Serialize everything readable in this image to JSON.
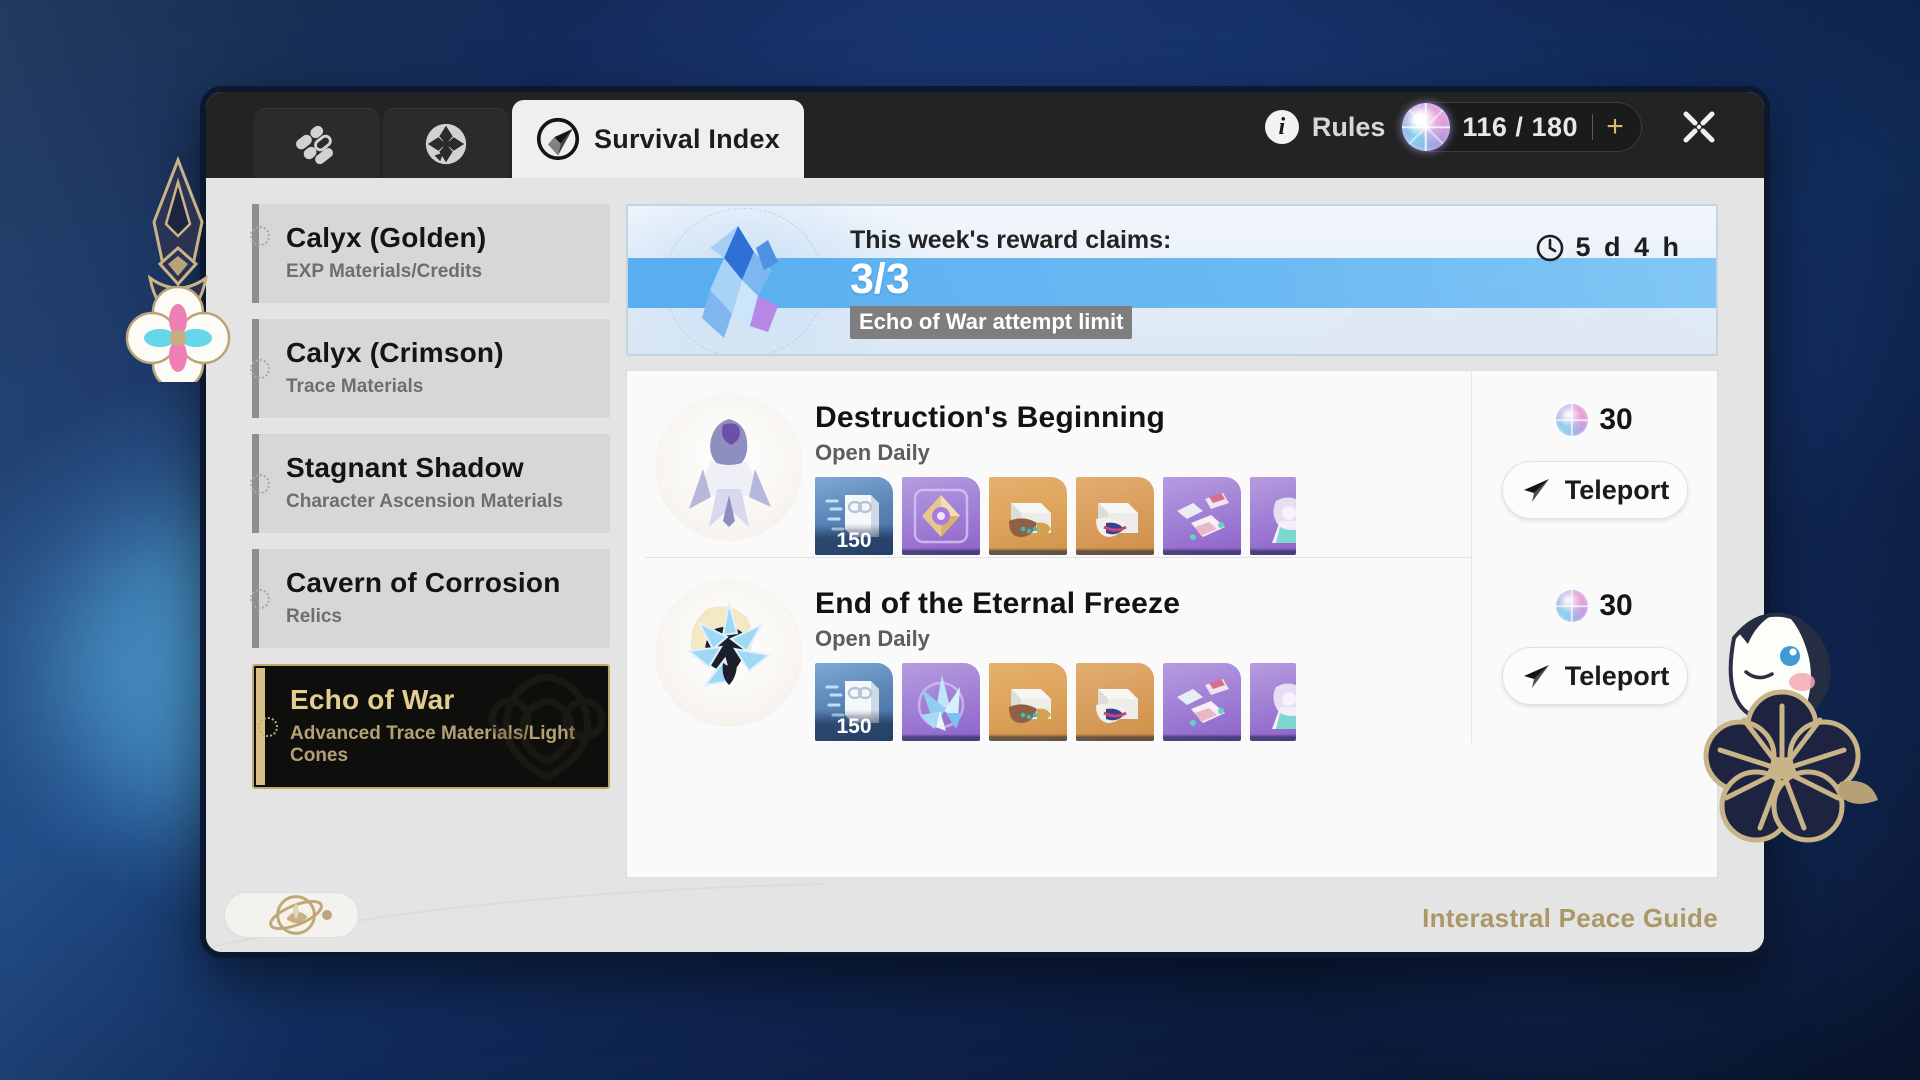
{
  "header": {
    "tabs": [
      {
        "id": "tab-assignments",
        "icon": "assignments-icon",
        "label": ""
      },
      {
        "id": "tab-calyx-cavern",
        "icon": "cavern-icon",
        "label": ""
      },
      {
        "id": "tab-survival-index",
        "icon": "survival-index-icon",
        "label": "Survival Index",
        "active": true
      }
    ],
    "rules_label": "Rules",
    "rules_icon": "info-icon",
    "power": {
      "icon": "trailblaze-power-icon",
      "value": "116 / 180",
      "plus_label": "+"
    },
    "close_icon": "close-icon"
  },
  "sidebar": {
    "items": [
      {
        "title": "Calyx (Golden)",
        "subtitle": "EXP Materials/Credits",
        "selected": false
      },
      {
        "title": "Calyx (Crimson)",
        "subtitle": "Trace Materials",
        "selected": false
      },
      {
        "title": "Stagnant Shadow",
        "subtitle": "Character Ascension Materials",
        "selected": false
      },
      {
        "title": "Cavern of Corrosion",
        "subtitle": "Relics",
        "selected": false
      },
      {
        "title": "Echo of War",
        "subtitle": "Advanced Trace Materials/Light Cones",
        "selected": true
      }
    ]
  },
  "banner": {
    "line1": "This week's reward claims:",
    "count": "3/3",
    "tooltip": "Echo of War attempt limit",
    "timer": "5 d 4 h",
    "timer_icon": "clock-icon",
    "crystal_icon": "blue-crystal-icon"
  },
  "stages": [
    {
      "title": "Destruction's Beginning",
      "subtitle": "Open Daily",
      "portrait_icon": "boss-cocolia-icon",
      "cost": "30",
      "cost_icon": "trailblaze-power-icon",
      "teleport_label": "Teleport",
      "teleport_icon": "paper-plane-icon",
      "rewards": [
        {
          "name": "credit-material-icon",
          "qty": "150",
          "tone": "r-blue"
        },
        {
          "name": "light-cone-icon",
          "qty": "",
          "tone": "r-purp"
        },
        {
          "name": "trace-material-a-icon",
          "qty": "",
          "tone": "r-gold"
        },
        {
          "name": "trace-material-b-icon",
          "qty": "",
          "tone": "r-gold2"
        },
        {
          "name": "relic-fragment-icon",
          "qty": "",
          "tone": "r-purp"
        },
        {
          "name": "character-material-icon",
          "qty": "",
          "tone": "r-purp"
        }
      ]
    },
    {
      "title": "End of the Eternal Freeze",
      "subtitle": "Open Daily",
      "portrait_icon": "boss-ice-icon",
      "cost": "30",
      "cost_icon": "trailblaze-power-icon",
      "teleport_label": "Teleport",
      "teleport_icon": "paper-plane-icon",
      "rewards": [
        {
          "name": "credit-material-icon",
          "qty": "150",
          "tone": "r-blue"
        },
        {
          "name": "ice-shard-icon",
          "qty": "",
          "tone": "r-purp"
        },
        {
          "name": "trace-material-a-icon",
          "qty": "",
          "tone": "r-gold"
        },
        {
          "name": "trace-material-b-icon",
          "qty": "",
          "tone": "r-gold2"
        },
        {
          "name": "relic-fragment-icon",
          "qty": "",
          "tone": "r-purp"
        },
        {
          "name": "character-material-icon",
          "qty": "",
          "tone": "r-purp"
        }
      ]
    }
  ],
  "footer": {
    "watermark": "Interastral Peace Guide",
    "nav_toggle_icon": "planet-icon"
  },
  "colors": {
    "accent_gold": "#c2a86a",
    "selected_title": "#e3cd93",
    "banner_band": "#5fb4f2",
    "window_bg": "#e4e4e4",
    "header_bg": "#232323"
  }
}
